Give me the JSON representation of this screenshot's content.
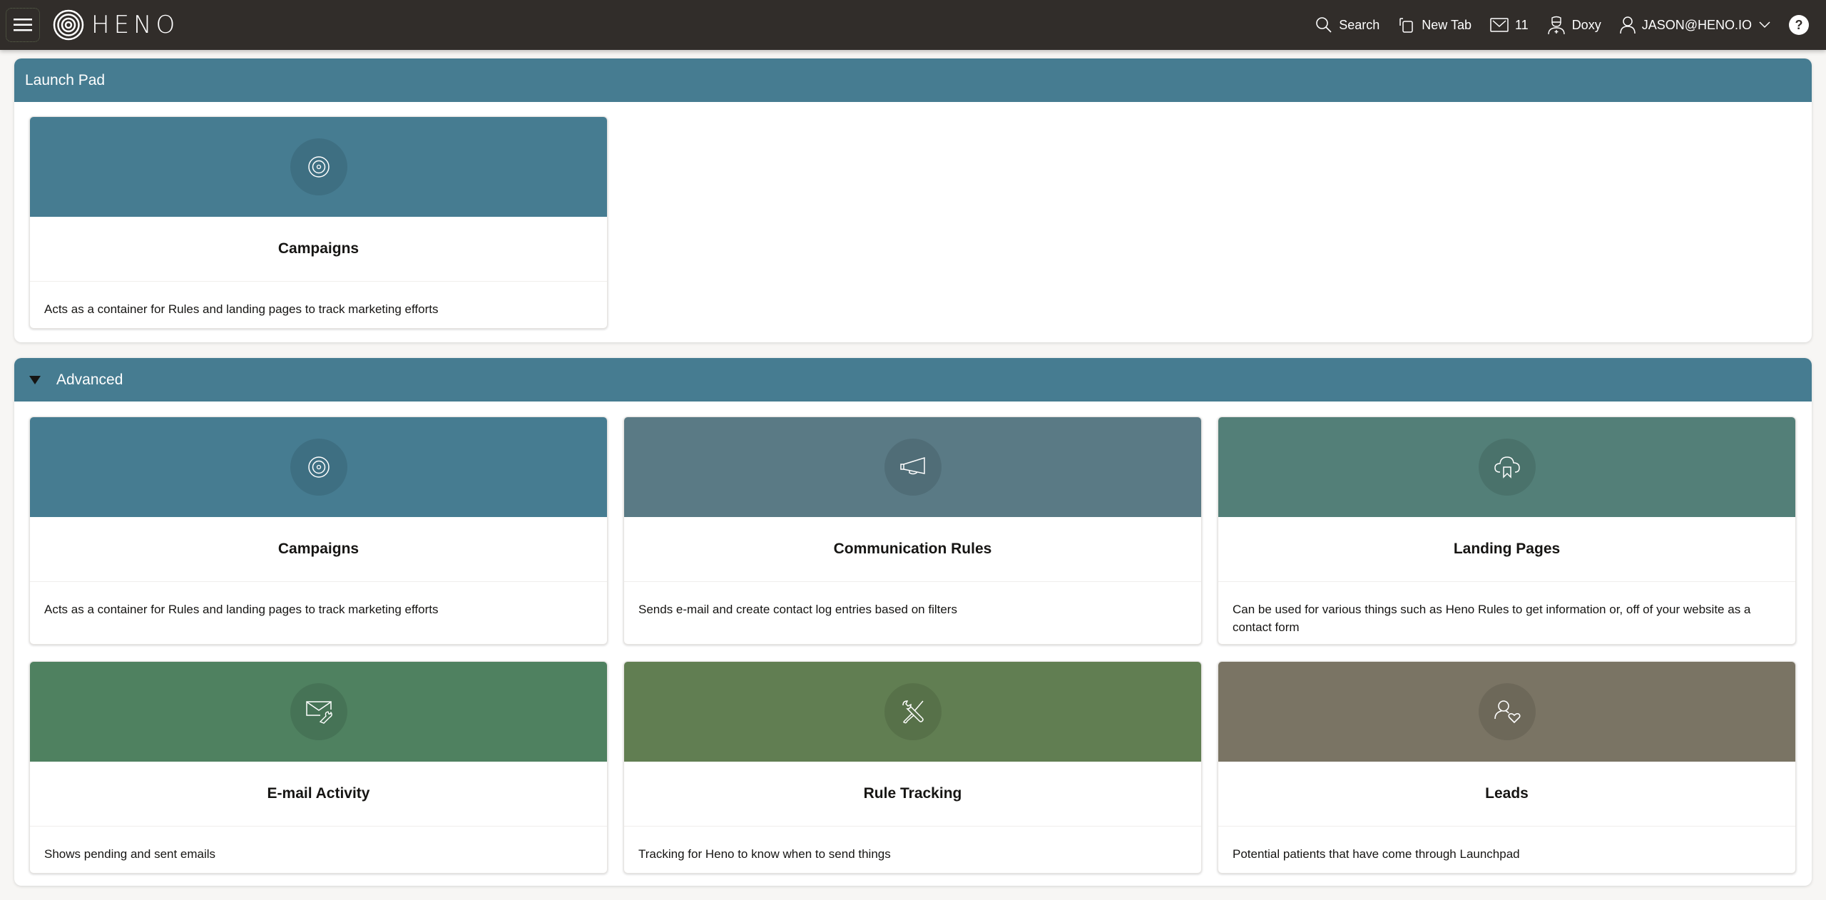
{
  "header": {
    "brand": "HENO",
    "search_label": "Search",
    "new_tab_label": "New Tab",
    "messages_count": "11",
    "doxy_label": "Doxy",
    "user_label": "JASON@HENO.IO",
    "help_label": "?"
  },
  "launch_pad": {
    "title": "Launch Pad",
    "cards": [
      {
        "title": "Campaigns",
        "description": "Acts as a container for Rules and landing pages to track marketing efforts",
        "icon": "target-icon",
        "color": "#467c91"
      }
    ]
  },
  "advanced": {
    "title": "Advanced",
    "expanded": true,
    "cards": [
      {
        "title": "Campaigns",
        "description": "Acts as a container for Rules and landing pages to track marketing efforts",
        "icon": "target-icon",
        "color": "#467c91"
      },
      {
        "title": "Communication Rules",
        "description": "Sends e-mail and create contact log entries based on filters",
        "icon": "megaphone-icon",
        "color": "#5a7a85"
      },
      {
        "title": "Landing Pages",
        "description": "Can be used for various things such as Heno Rules to get information or, off of your website as a contact form",
        "icon": "cloud-bookmark-icon",
        "color": "#537f78"
      },
      {
        "title": "E-mail Activity",
        "description": "Shows pending and sent emails",
        "icon": "email-wrench-icon",
        "color": "#4f8160"
      },
      {
        "title": "Rule Tracking",
        "description": "Tracking for Heno to know when to send things",
        "icon": "tools-icon",
        "color": "#617e52"
      },
      {
        "title": "Leads",
        "description": "Potential patients that have come through Launchpad",
        "icon": "user-heart-icon",
        "color": "#7a7464"
      }
    ]
  }
}
